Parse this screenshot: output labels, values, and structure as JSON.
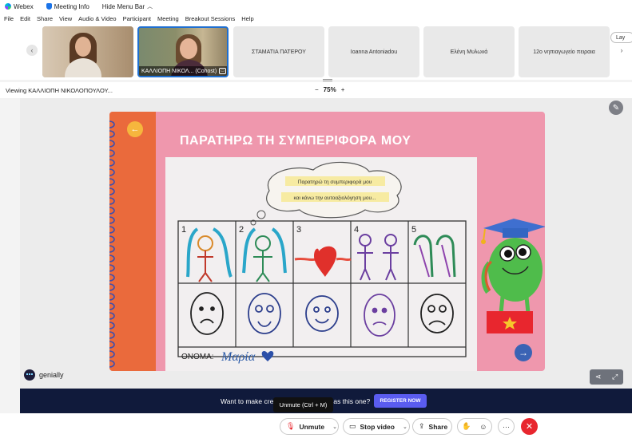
{
  "titlebar": {
    "app_name": "Webex",
    "meeting_info": "Meeting Info",
    "hide_menu_bar": "Hide Menu Bar"
  },
  "menubar": {
    "items": [
      "File",
      "Edit",
      "Share",
      "View",
      "Audio & Video",
      "Participant",
      "Meeting",
      "Breakout Sessions",
      "Help"
    ]
  },
  "participants": {
    "tiles": [
      {
        "name": ""
      },
      {
        "name": "ΚΑΛΛΙΟΠΗ ΝΙΚΟΛ... (Cohost)"
      },
      {
        "name": "ΣΤΑΜΑΤΙΑ ΠΑΤΕΡΟΥ"
      },
      {
        "name": "Ioanna Antoniadou"
      },
      {
        "name": "Ελένη Μυλωνά"
      },
      {
        "name": "12ο νηπιαγωγείο πειραια"
      }
    ],
    "layout_label": "Lay"
  },
  "viewbar": {
    "viewing_text": "Viewing ΚΑΛΛΙΟΠΗ ΝΙΚΟΛΟΠΟΥΛΟΥ...",
    "zoom_minus": "−",
    "zoom_level": "75%",
    "zoom_plus": "+"
  },
  "slide": {
    "title": "ΠΑΡΑΤΗΡΩ ΤΗ ΣΥΜΠΕΡΙΦΟΡΑ ΜΟΥ",
    "cloud_line1": "Παρατηρώ τη συμπεριφορά μου",
    "cloud_line2": "και κάνω την αυτοαξιολόγηση μου...",
    "column_numbers": [
      "1",
      "2",
      "3",
      "4",
      "5"
    ],
    "name_label": "ONOMA:",
    "name_value": "Μαρία"
  },
  "genially": {
    "brand": "genially"
  },
  "banner": {
    "text": "Want to make creations as awesome as this one?",
    "button": "REGISTER NOW"
  },
  "tooltip": {
    "text": "Unmute (Ctrl + M)"
  },
  "toolbar": {
    "unmute": "Unmute",
    "stop_video": "Stop video",
    "share": "Share"
  },
  "colors": {
    "slide_pink": "#ef97ad",
    "slide_orange": "#ea6a3c",
    "banner_navy": "#101a3b",
    "register_button": "#5a5cf0",
    "end_call_red": "#e8262e",
    "active_tile_border": "#1f6fd1"
  }
}
